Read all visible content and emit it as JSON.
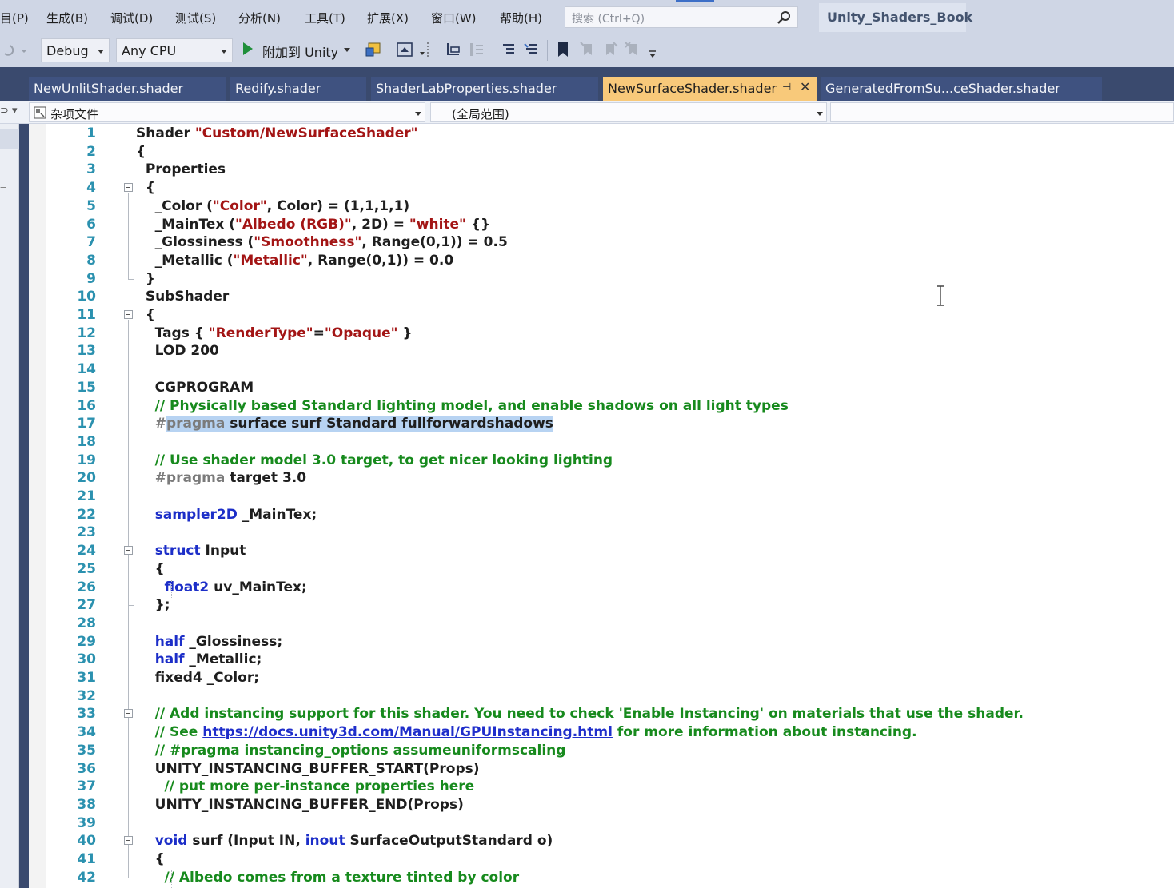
{
  "menu": {
    "items": [
      "目(P)",
      "生成(B)",
      "调试(D)",
      "测试(S)",
      "分析(N)",
      "工具(T)",
      "扩展(X)",
      "窗口(W)",
      "帮助(H)"
    ],
    "search_placeholder": "搜索 (Ctrl+Q)",
    "solution_name": "Unity_Shaders_Book"
  },
  "toolbar": {
    "configuration": "Debug",
    "platform": "Any CPU",
    "attach_label": "附加到 Unity"
  },
  "tabs": [
    {
      "label": "NewUnlitShader.shader",
      "active": false
    },
    {
      "label": "Redify.shader",
      "active": false
    },
    {
      "label": "ShaderLabProperties.shader",
      "active": false
    },
    {
      "label": "NewSurfaceShader.shader",
      "active": true
    },
    {
      "label": "GeneratedFromSu...ceShader.shader",
      "active": false
    }
  ],
  "navbar": {
    "project": "杂项文件",
    "scope": "(全局范围)"
  },
  "editor": {
    "line_numbers": [
      "1",
      "2",
      "3",
      "4",
      "5",
      "6",
      "7",
      "8",
      "9",
      "10",
      "11",
      "12",
      "13",
      "14",
      "15",
      "16",
      "17",
      "18",
      "19",
      "20",
      "21",
      "22",
      "23",
      "24",
      "25",
      "26",
      "27",
      "28",
      "29",
      "30",
      "31",
      "32",
      "33",
      "34",
      "35",
      "36",
      "37",
      "38",
      "39",
      "40",
      "41",
      "42"
    ],
    "lines": [
      [
        {
          "t": "Shader "
        },
        {
          "t": "\"Custom/NewSurfaceShader\"",
          "c": "str"
        }
      ],
      [
        {
          "t": "{"
        }
      ],
      [
        {
          "t": "  Properties"
        }
      ],
      [
        {
          "t": "  {"
        }
      ],
      [
        {
          "t": "    _Color ("
        },
        {
          "t": "\"Color\"",
          "c": "str"
        },
        {
          "t": ", Color) = (1,1,1,1)"
        }
      ],
      [
        {
          "t": "    _MainTex ("
        },
        {
          "t": "\"Albedo (RGB)\"",
          "c": "str"
        },
        {
          "t": ", 2D) = "
        },
        {
          "t": "\"white\"",
          "c": "str"
        },
        {
          "t": " {}"
        }
      ],
      [
        {
          "t": "    _Glossiness ("
        },
        {
          "t": "\"Smoothness\"",
          "c": "str"
        },
        {
          "t": ", Range(0,1)) = 0.5"
        }
      ],
      [
        {
          "t": "    _Metallic ("
        },
        {
          "t": "\"Metallic\"",
          "c": "str"
        },
        {
          "t": ", Range(0,1)) = 0.0"
        }
      ],
      [
        {
          "t": "  }"
        }
      ],
      [
        {
          "t": "  SubShader"
        }
      ],
      [
        {
          "t": "  {"
        }
      ],
      [
        {
          "t": "    Tags { "
        },
        {
          "t": "\"RenderType\"",
          "c": "str"
        },
        {
          "t": "="
        },
        {
          "t": "\"Opaque\"",
          "c": "str"
        },
        {
          "t": " }"
        }
      ],
      [
        {
          "t": "    LOD 200"
        }
      ],
      [],
      [
        {
          "t": "    CGPROGRAM"
        }
      ],
      [
        {
          "t": "    // Physically based Standard lighting model, and enable shadows on all light types",
          "c": "cm"
        }
      ],
      [
        {
          "t": "    "
        },
        {
          "t": "#",
          "c": "pp"
        },
        {
          "t": "pragma",
          "c": "pp sel"
        },
        {
          "t": " surface surf Standard fullforwardshadows",
          "c": "sel"
        }
      ],
      [],
      [
        {
          "t": "    // Use shader model 3.0 target, to get nicer looking lighting",
          "c": "cm"
        }
      ],
      [
        {
          "t": "    "
        },
        {
          "t": "#pragma",
          "c": "pp"
        },
        {
          "t": " target 3.0"
        }
      ],
      [],
      [
        {
          "t": "    "
        },
        {
          "t": "sampler2D",
          "c": "kw"
        },
        {
          "t": " _MainTex;"
        }
      ],
      [],
      [
        {
          "t": "    "
        },
        {
          "t": "struct",
          "c": "kw"
        },
        {
          "t": " Input"
        }
      ],
      [
        {
          "t": "    {"
        }
      ],
      [
        {
          "t": "      "
        },
        {
          "t": "float2",
          "c": "kw"
        },
        {
          "t": " uv_MainTex;"
        }
      ],
      [
        {
          "t": "    };"
        }
      ],
      [],
      [
        {
          "t": "    "
        },
        {
          "t": "half",
          "c": "kw"
        },
        {
          "t": " _Glossiness;"
        }
      ],
      [
        {
          "t": "    "
        },
        {
          "t": "half",
          "c": "kw"
        },
        {
          "t": " _Metallic;"
        }
      ],
      [
        {
          "t": "    fixed4 _Color;"
        }
      ],
      [],
      [
        {
          "t": "    // Add instancing support for this shader. You need to check 'Enable Instancing' on materials that use the shader.",
          "c": "cm"
        }
      ],
      [
        {
          "t": "    // See ",
          "c": "cm"
        },
        {
          "t": "https://docs.unity3d.com/Manual/GPUInstancing.html",
          "c": "link"
        },
        {
          "t": " for more information about instancing.",
          "c": "cm"
        }
      ],
      [
        {
          "t": "    // #pragma instancing_options assumeuniformscaling",
          "c": "cm"
        }
      ],
      [
        {
          "t": "    UNITY_INSTANCING_BUFFER_START(Props)"
        }
      ],
      [
        {
          "t": "      // put more per-instance properties here",
          "c": "cm"
        }
      ],
      [
        {
          "t": "    UNITY_INSTANCING_BUFFER_END(Props)"
        }
      ],
      [],
      [
        {
          "t": "    "
        },
        {
          "t": "void",
          "c": "kw"
        },
        {
          "t": " surf (Input IN, "
        },
        {
          "t": "inout",
          "c": "kw"
        },
        {
          "t": " SurfaceOutputStandard o)"
        }
      ],
      [
        {
          "t": "    {"
        }
      ],
      [
        {
          "t": "      // Albedo comes from a texture tinted by color",
          "c": "cm"
        }
      ]
    ]
  },
  "colors": {
    "tab_active": "#f8c97a",
    "chrome_dark": "#3a4a6e",
    "keyword": "#1c2ec8",
    "string": "#a31515",
    "comment": "#178a1d",
    "line_number": "#2b91af",
    "selection": "#b7d3f2"
  },
  "icons": [
    "search-icon",
    "undo-icon",
    "start-icon",
    "debug-window-icon",
    "browser-icon",
    "step-icon",
    "format-icon",
    "comment-icon",
    "uncomment-icon",
    "bookmark-icon",
    "prev-bookmark-icon",
    "next-bookmark-icon",
    "clear-bookmark-icon",
    "collapse-icon",
    "pin-icon",
    "close-icon",
    "text-cursor-icon"
  ]
}
